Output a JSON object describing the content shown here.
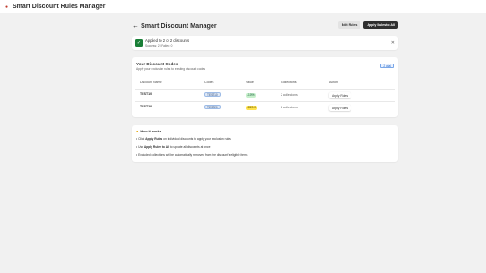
{
  "app": {
    "title": "Smart Discount Rules Manager"
  },
  "header": {
    "title": "Smart Discount Manager",
    "edit_rules_label": "Edit Rules",
    "apply_all_label": "Apply Rules to All"
  },
  "banner": {
    "title": "Applied to 2 of 2 discounts",
    "subtitle": "Success: 2 | Failed: 0"
  },
  "codes_card": {
    "title": "Your Discount Codes",
    "subtitle": "Apply your exclusion rules to existing discount codes",
    "badge": "2 total",
    "columns": [
      "Discount Name",
      "Codes",
      "Value",
      "Collections",
      "Action"
    ],
    "rows": [
      {
        "name": "TEST10",
        "code": "TEST10",
        "value": "-10%",
        "collections": "2 collections",
        "action": "Apply Rules"
      },
      {
        "name": "TEST20",
        "code": "TEST20",
        "value": "-$20.0",
        "collections": "2 collections",
        "action": "Apply Rules"
      }
    ]
  },
  "how_card": {
    "title": "How it works",
    "b1_pre": "• Click ",
    "b1_bold": "Apply Rules",
    "b1_post": " on individual discounts to apply your exclusion rules",
    "b2_pre": "• Use ",
    "b2_bold": "Apply Rules to All",
    "b2_post": " to update all discounts at once",
    "b3": "• Excluded collections will be automatically removed from the discount's eligible items"
  },
  "colors": {
    "success_green": "#1a7f37",
    "primary_dark": "#303030",
    "value_green_bg": "#c7f0cc",
    "value_yellow_bg": "#ffe34f",
    "code_blue_bg": "#dfe9f7"
  },
  "icons": [
    "app-logo-icon",
    "back-arrow-icon",
    "checkmark-icon",
    "close-icon",
    "lightbulb-icon"
  ]
}
